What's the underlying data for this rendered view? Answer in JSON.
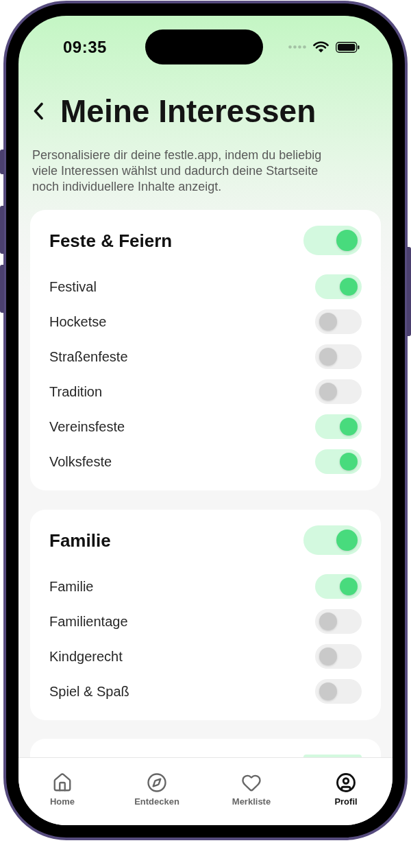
{
  "status_bar": {
    "time": "09:35"
  },
  "header": {
    "title": "Meine Interessen"
  },
  "description": [
    "Personalisiere dir deine festle.app, indem du beliebig",
    "viele Interessen wählst und dadurch deine Startseite",
    "noch individuellere Inhalte anzeigt."
  ],
  "cards": [
    {
      "title": "Feste & Feiern",
      "on": true,
      "items": [
        {
          "label": "Festival",
          "on": true
        },
        {
          "label": "Hocketse",
          "on": false
        },
        {
          "label": "Straßenfeste",
          "on": false
        },
        {
          "label": "Tradition",
          "on": false
        },
        {
          "label": "Vereinsfeste",
          "on": true
        },
        {
          "label": "Volksfeste",
          "on": true
        }
      ]
    },
    {
      "title": "Familie",
      "on": true,
      "items": [
        {
          "label": "Familie",
          "on": true
        },
        {
          "label": "Familientage",
          "on": false
        },
        {
          "label": "Kindgerecht",
          "on": false
        },
        {
          "label": "Spiel & Spaß",
          "on": false
        }
      ]
    },
    {
      "on": true
    }
  ],
  "nav": [
    {
      "label": "Home",
      "selected": false
    },
    {
      "label": "Entdecken",
      "selected": false
    },
    {
      "label": "Merkliste",
      "selected": false
    },
    {
      "label": "Profil",
      "selected": true
    }
  ]
}
